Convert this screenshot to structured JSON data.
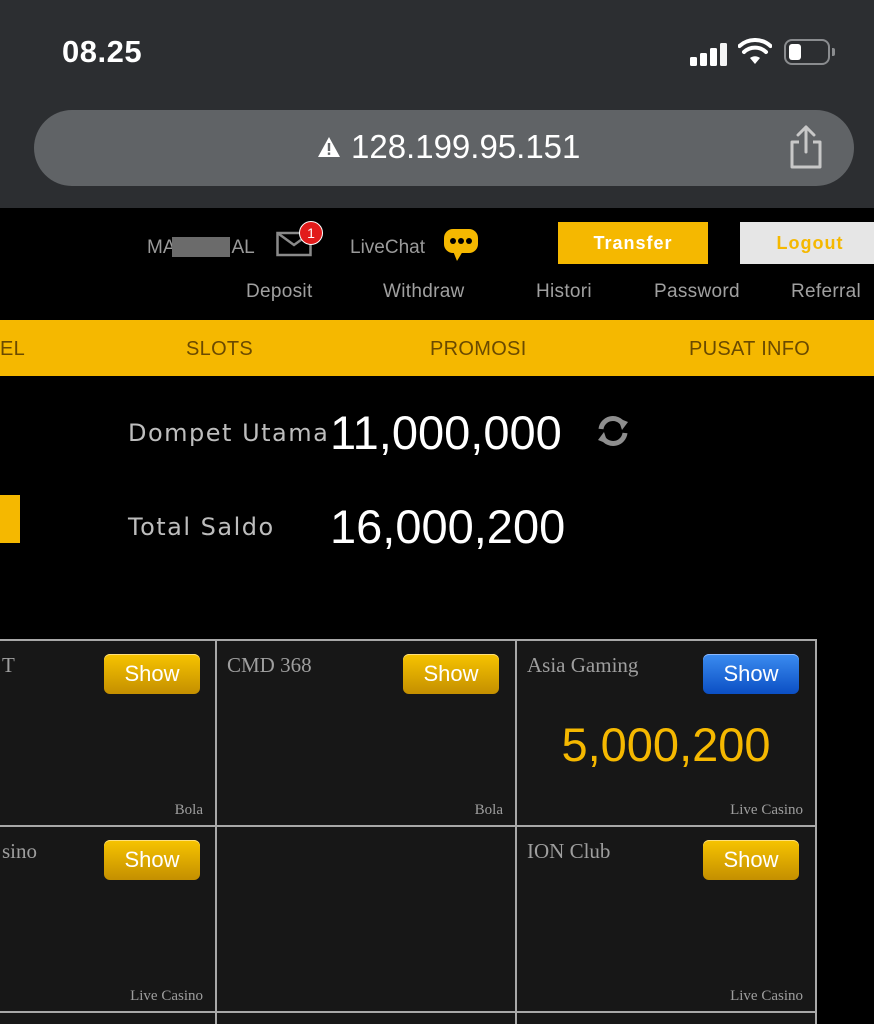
{
  "status_bar": {
    "time": "08.25"
  },
  "browser": {
    "url": "128.199.95.151"
  },
  "header": {
    "username": "MA",
    "username_tail": "AL",
    "mail_badge": "1",
    "livechat_label": "LiveChat",
    "transfer_label": "Transfer",
    "logout_label": "Logout"
  },
  "sublinks": [
    "Deposit",
    "Withdraw",
    "Histori",
    "Password",
    "Referral"
  ],
  "nav": {
    "items": [
      "EL",
      "SLOTS",
      "PROMOSI",
      "PUSAT INFO"
    ]
  },
  "wallet": {
    "main_label": "Dompet Utama",
    "main_value": "11,000,000",
    "total_label": "Total Saldo",
    "total_value": "16,000,200"
  },
  "providers": [
    {
      "name": "T",
      "type": "Bola",
      "show": "Show",
      "balance": "",
      "button_color": "gold"
    },
    {
      "name": "CMD 368",
      "type": "Bola",
      "show": "Show",
      "balance": "",
      "button_color": "gold"
    },
    {
      "name": "Asia Gaming",
      "type": "Live Casino",
      "show": "Show",
      "balance": "5,000,200",
      "button_color": "blue"
    },
    {
      "name": "sino",
      "type": "Live Casino",
      "show": "Show",
      "balance": "",
      "button_color": "gold"
    },
    {
      "name": "",
      "type": "",
      "show": "",
      "balance": "",
      "button_color": ""
    },
    {
      "name": "ION Club",
      "type": "Live Casino",
      "show": "Show",
      "balance": "",
      "button_color": "gold"
    }
  ],
  "colors": {
    "accent": "#f5b800",
    "background": "#000000",
    "cell": "#171717",
    "blue_button": "#1f6fe0"
  }
}
